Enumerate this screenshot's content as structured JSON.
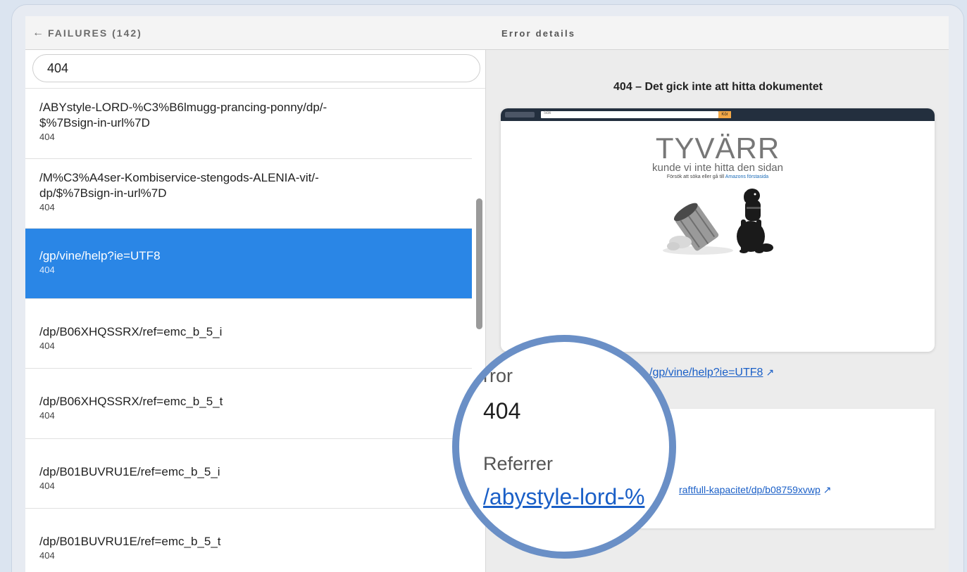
{
  "header": {
    "back_label": "FAILURES (142)",
    "detail_title": "Error details"
  },
  "search": {
    "value": "404"
  },
  "failures": [
    {
      "path_line1": "/ABYstyle-LORD-%C3%B6lmugg-prancing-ponny/dp/-",
      "path_line2": "$%7Bsign-in-url%7D",
      "code": "404"
    },
    {
      "path_line1": "/M%C3%A4ser-Kombiservice-stengods-ALENIA-vit/-",
      "path_line2": "dp/$%7Bsign-in-url%7D",
      "code": "404"
    },
    {
      "path_line1": "/gp/vine/help?ie=UTF8",
      "code": "404",
      "selected": true
    },
    {
      "path_line1": "/dp/B06XHQSSRX/ref=emc_b_5_i",
      "code": "404"
    },
    {
      "path_line1": "/dp/B06XHQSSRX/ref=emc_b_5_t",
      "code": "404"
    },
    {
      "path_line1": "/dp/B01BUVRU1E/ref=emc_b_5_i",
      "code": "404"
    },
    {
      "path_line1": "/dp/B01BUVRU1E/ref=emc_b_5_t",
      "code": "404"
    }
  ],
  "detail": {
    "heading": "404 – Det gick inte att hitta dokumentet",
    "screenshot": {
      "search_placeholder": "Sök",
      "go_label": "Kör",
      "big_title": "TYVÄRR",
      "subtitle": "kunde vi inte hitta den sidan",
      "hint_prefix": "Försök att söka eller gå till ",
      "hint_link": "Amazons förstasida"
    },
    "url_link": "/gp/vine/help?ie=UTF8",
    "referrer_link": "raftfull-kapacitet/dp/b08759xvwp"
  },
  "magnifier": {
    "error_label": "rror",
    "error_value": "404",
    "referrer_label": "Referrer",
    "referrer_value": "/abystyle-lord-%"
  },
  "colors": {
    "selected_row": "#2a86e6",
    "link": "#1a5fc7",
    "magnifier_ring": "#6a8fc6"
  }
}
